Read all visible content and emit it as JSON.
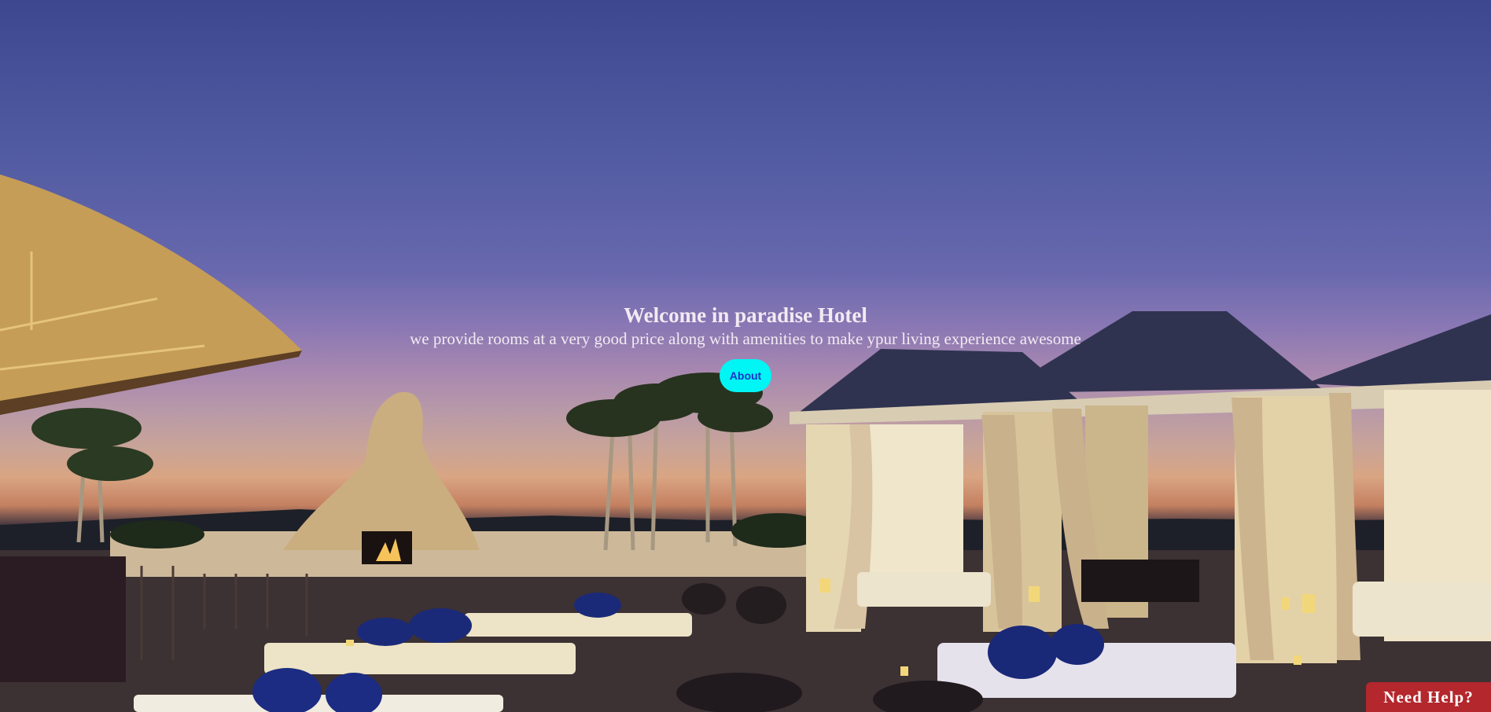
{
  "hero": {
    "title": "Welcome in paradise Hotel",
    "subtitle": "we provide rooms at a very good price along with amenities to make ypur living experience awesome",
    "about_label": "About"
  },
  "help": {
    "label": "Need Help?"
  },
  "colors": {
    "about_button_bg": "#00f5f5",
    "about_button_text": "#1a33c7",
    "help_button_bg": "#b3272d",
    "hero_text": "#f3eaf2"
  }
}
